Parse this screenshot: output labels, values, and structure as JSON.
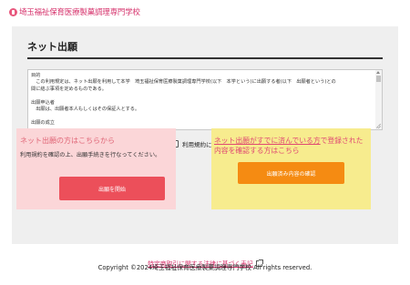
{
  "header": {
    "site_name": "埼玉福祉保育医療製菓調理専門学校"
  },
  "page": {
    "title": "ネット出願"
  },
  "terms": {
    "lines": [
      "目的",
      "　この利用規定は、ネット出願を利用して本学　埼玉福祉保育医療製菓調理専門学校(以下　本学という)に出願する者(以下　出願者という)との",
      "間に結ぶ事項を定めるものである。",
      "",
      "出願申込者",
      "　出願は、出願者本人もしくはその保証人とする。",
      "",
      "出願の成立"
    ]
  },
  "agree": {
    "label": "利用規約に同意する",
    "checked": false
  },
  "apply_card": {
    "title": "ネット出願の方はこちらから",
    "description": "利用規約を確認の上、出願手続きを行なってください。",
    "button_label": "出願を開始"
  },
  "confirm_card": {
    "title_link": "ネット出願がすでに済んでいる方",
    "title_rest": "で登録された内容を確認する方はこちら",
    "button_label": "出願済み内容の確認"
  },
  "footer": {
    "law_link": "特定商取引に関する法律に基づく表記",
    "copyright": "Copyright ©2024埼玉福祉保育医療製菓調理専門学校 All rights reserved."
  },
  "colors": {
    "brand_pink": "#d6336c",
    "apply_card_bg": "#fbd6d8",
    "apply_button": "#ec4f5a",
    "confirm_card_bg": "#f7ec8e",
    "confirm_button": "#f58b12",
    "panel_bg": "#efefef"
  }
}
